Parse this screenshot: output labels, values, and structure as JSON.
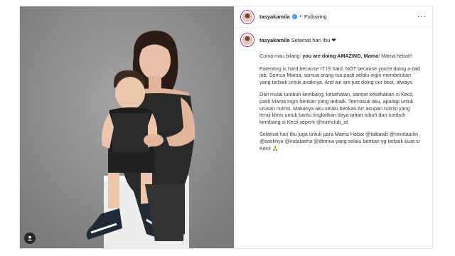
{
  "post": {
    "username": "tasyakamila",
    "follow_state": "Following",
    "dot": "•",
    "more": "···",
    "caption": {
      "username": "tasyakamila",
      "headline": "Selamat hari Ibu ❤",
      "p1_pre": "Cuma mau bilang: ",
      "p1_bold": "you are doing AMAZING, Mama",
      "p1_post": "! Mama hebat!!",
      "p2": "Parenting is hard because IT IS hard. NOT because you're doing a bad job. Semua Mama, semua orang tua pasti selalu ingin memberikan yang terbaik untuk anaknya. And we are just doing our best, always.",
      "p3": "Dari mulai tumbuh kembang, kesehatan, sampe keseharian si Kecil, pasti Mama ingin berikan yang terbaik. Termasuk aku, apalagi untuk urusan nutrisi. Makanya aku selalu berikan Arr asupan nutrisi yang teruji klinis untuk bantu tingkatkan daya tahan tubuh dan tumbuh kembang si Kecil seperti @nutriclub_id.",
      "p4": "Selamat hari Ibu juga untuk para Mama Hebat @talitawb @reinitaarlin @saskhya @indatasha @dhenia yang selalu berikan yg terbaik buat si Kecil 🙏"
    }
  },
  "colors": {
    "verified": "#3897f0",
    "avatar_ring": "#d6249f",
    "photo_bg": "#8d8d8d"
  },
  "icons": [
    "verified-icon",
    "more-icon",
    "tag-icon"
  ]
}
